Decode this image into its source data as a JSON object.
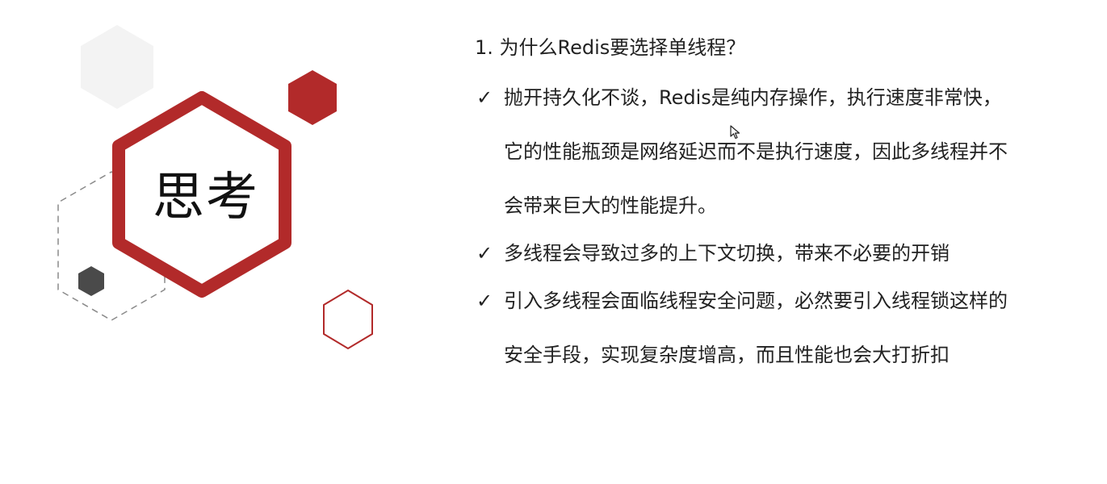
{
  "slide": {
    "title": "思考",
    "question": "1.  为什么Redis要选择单线程？",
    "bullet_glyph": "✓",
    "points": [
      {
        "text": "抛开持久化不谈，Redis是纯内存操作，执行速度非常快，它的性能瓶颈是网络延迟而不是执行速度，因此多线程并不会带来巨大的性能提升。"
      },
      {
        "text": "多线程会导致过多的上下文切换，带来不必要的开销"
      },
      {
        "text": "引入多线程会面临线程安全问题，必然要引入线程锁这样的安全手段，实现复杂度增高，而且性能也会大打折扣"
      }
    ]
  },
  "colors": {
    "accent_red": "#b22a2a",
    "dark_gray": "#4a4a4a",
    "light_gray": "#f3f3f3",
    "dash_gray": "#8a8a8a",
    "text": "#222222"
  },
  "icons": {
    "cursor": "mouse-pointer-icon",
    "check": "checkmark-icon"
  }
}
